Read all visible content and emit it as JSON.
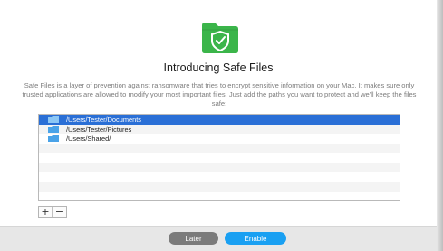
{
  "header": {
    "icon": "shield-folder-icon",
    "icon_color": "#3bb54a",
    "title": "Introducing Safe Files"
  },
  "description": "Safe Files is a layer of prevention against ransomware that tries to encrypt sensitive information on your Mac. It makes sure only trusted applications are allowed to modify your most important files. Just add the paths you want to protect and we'll keep the files safe:",
  "paths": [
    {
      "path": "/Users/Tester/Documents",
      "selected": true
    },
    {
      "path": "/Users/Tester/Pictures",
      "selected": false
    },
    {
      "path": "/Users/Shared/",
      "selected": false
    }
  ],
  "controls": {
    "add_label": "+",
    "remove_label": "−"
  },
  "footer": {
    "later_label": "Later",
    "enable_label": "Enable"
  },
  "colors": {
    "selection": "#2a6fd6",
    "enable_button": "#1aa0f2",
    "later_button": "#7b7b7b",
    "folder": "#4aa3e8"
  }
}
